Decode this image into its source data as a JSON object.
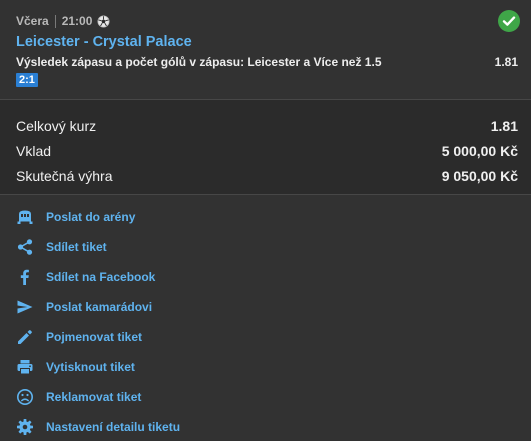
{
  "bet": {
    "day": "Včera",
    "time": "21:00",
    "sport_icon": "football-icon",
    "status_icon": "check-circle-icon",
    "status_color": "#3fa648",
    "match": "Leicester - Crystal Palace",
    "market": "Výsledek zápasu a počet gólů v zápasu: Leicester a Více než 1.5",
    "odds": "1.81",
    "score": "2:1"
  },
  "summary": {
    "total_odds_label": "Celkový kurz",
    "total_odds_value": "1.81",
    "stake_label": "Vklad",
    "stake_value": "5 000,00 Kč",
    "win_label": "Skutečná výhra",
    "win_value": "9 050,00 Kč"
  },
  "actions": [
    {
      "icon": "arena-icon",
      "label": "Poslat do arény"
    },
    {
      "icon": "share-icon",
      "label": "Sdílet tiket"
    },
    {
      "icon": "facebook-icon",
      "label": "Sdílet na Facebook"
    },
    {
      "icon": "send-icon",
      "label": "Poslat kamarádovi"
    },
    {
      "icon": "pencil-icon",
      "label": "Pojmenovat tiket"
    },
    {
      "icon": "printer-icon",
      "label": "Vytisknout tiket"
    },
    {
      "icon": "sad-face-icon",
      "label": "Reklamovat tiket"
    },
    {
      "icon": "gear-icon",
      "label": "Nastavení detailu tiketu"
    }
  ],
  "colors": {
    "link": "#5fb3ef",
    "background": "#323232",
    "panel": "#2b2b2b",
    "score_badge": "#2a7fd4"
  }
}
